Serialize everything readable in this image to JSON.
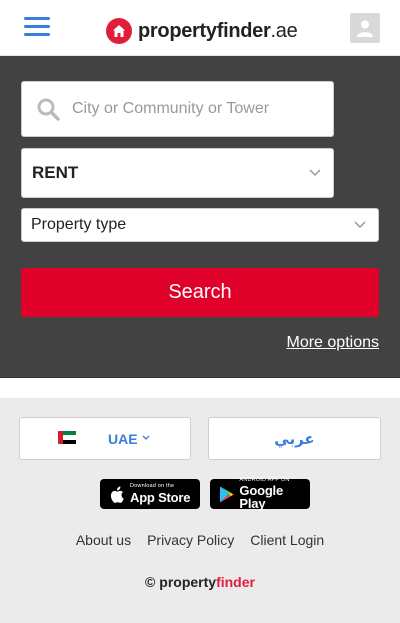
{
  "header": {
    "logo_text_dark": "property",
    "logo_text_bold": "finder",
    "logo_suffix": ".ae",
    "menu_icon": "hamburger-icon",
    "user_icon": "user-icon"
  },
  "search": {
    "location_placeholder": "City or Community or Tower",
    "listing_type": "RENT",
    "property_type": "Property type",
    "search_label": "Search",
    "more_options_label": "More options"
  },
  "footer": {
    "country_label": "UAE",
    "arabic_label": "عربي",
    "app_store": {
      "small": "Download on the",
      "big": "App Store"
    },
    "google_play": {
      "small": "ANDROID APP ON",
      "big": "Google Play"
    },
    "links": [
      "About us",
      "Privacy Policy",
      "Client Login"
    ],
    "copyright_symbol": "©",
    "copyright_brand_1": "property",
    "copyright_brand_2": "finder"
  },
  "colors": {
    "brand_red": "#e01e3c",
    "search_button": "#e0012b",
    "panel_bg": "#424243",
    "link_blue": "#3b7ddd",
    "footer_bg": "#ebebeb"
  }
}
